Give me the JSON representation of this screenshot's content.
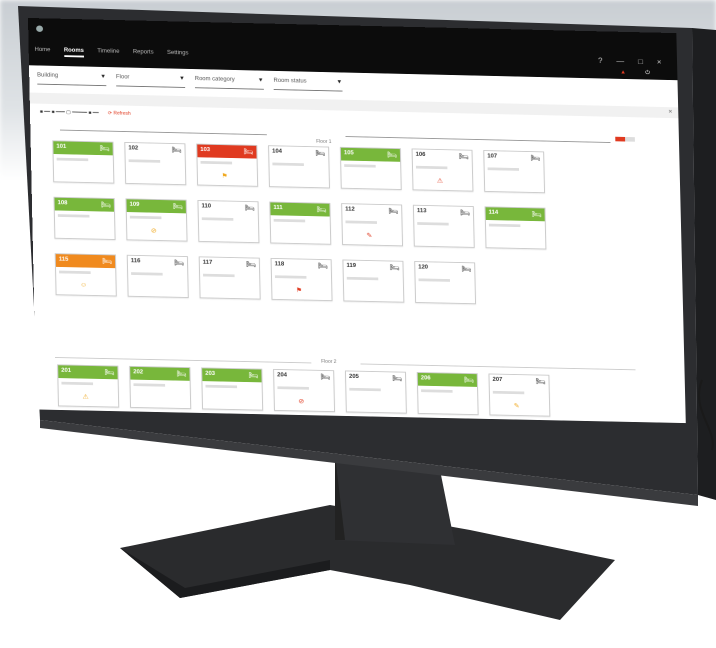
{
  "app": {
    "logo_text": "",
    "clock_text": "",
    "window_controls": "? — □ ×"
  },
  "nav": {
    "items": [
      {
        "label": "Home",
        "active": false
      },
      {
        "label": "Rooms",
        "active": true
      },
      {
        "label": "Timeline",
        "active": false
      },
      {
        "label": "Reports",
        "active": false
      },
      {
        "label": "Settings",
        "active": false
      }
    ]
  },
  "alert": {
    "label": ""
  },
  "filters": [
    {
      "label": "Building"
    },
    {
      "label": "Floor"
    },
    {
      "label": "Room category"
    },
    {
      "label": "Room status"
    }
  ],
  "legend": {
    "refresh": "Refresh"
  },
  "center_title": "",
  "floors": [
    {
      "label": "Floor 1"
    },
    {
      "label": "Floor 2"
    }
  ],
  "rooms": [
    {
      "number": "101",
      "status": "green",
      "icon": "bed-icon"
    },
    {
      "number": "102",
      "status": "white",
      "icon": "bed-icon"
    },
    {
      "number": "103",
      "status": "red",
      "icon": "bed-icon"
    },
    {
      "number": "104",
      "status": "white",
      "icon": "bed-icon"
    },
    {
      "number": "105",
      "status": "green",
      "icon": "bed-icon"
    },
    {
      "number": "106",
      "status": "white",
      "icon": "bed-icon"
    },
    {
      "number": "107",
      "status": "white",
      "icon": "bed-icon"
    },
    {
      "number": "108",
      "status": "green",
      "icon": "bed-icon"
    },
    {
      "number": "109",
      "status": "green",
      "icon": "bed-icon"
    },
    {
      "number": "110",
      "status": "white",
      "icon": "bed-icon"
    },
    {
      "number": "111",
      "status": "green",
      "icon": "bed-icon"
    },
    {
      "number": "112",
      "status": "white",
      "icon": "bed-icon"
    },
    {
      "number": "113",
      "status": "white",
      "icon": "bed-icon"
    },
    {
      "number": "114",
      "status": "green",
      "icon": "bed-icon"
    },
    {
      "number": "115",
      "status": "orange",
      "icon": "bed-icon"
    },
    {
      "number": "116",
      "status": "white",
      "icon": "bed-icon"
    },
    {
      "number": "117",
      "status": "white",
      "icon": "bed-icon"
    },
    {
      "number": "118",
      "status": "white",
      "icon": "bed-icon"
    },
    {
      "number": "119",
      "status": "white",
      "icon": "bed-icon"
    },
    {
      "number": "120",
      "status": "white",
      "icon": "bed-icon"
    },
    {
      "number": "201",
      "status": "green",
      "icon": "bed-icon"
    },
    {
      "number": "202",
      "status": "green",
      "icon": "bed-icon"
    },
    {
      "number": "203",
      "status": "green",
      "icon": "bed-icon"
    },
    {
      "number": "204",
      "status": "white",
      "icon": "bed-icon"
    },
    {
      "number": "205",
      "status": "white",
      "icon": "bed-icon"
    },
    {
      "number": "206",
      "status": "green",
      "icon": "bed-icon"
    },
    {
      "number": "207",
      "status": "white",
      "icon": "bed-icon"
    }
  ],
  "colors": {
    "green": "#78b73b",
    "red": "#e03a20",
    "orange": "#f08a1e",
    "topbar": "#0c0c0c"
  }
}
